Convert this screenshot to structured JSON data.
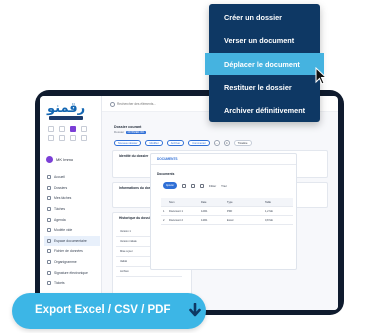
{
  "app": {
    "logo_text": "رقمنو",
    "workspace": "MK Immo"
  },
  "search": {
    "placeholder": "Rechercher des éléments..."
  },
  "sidebar": {
    "items": [
      {
        "label": "Accueil"
      },
      {
        "label": "Dossiers"
      },
      {
        "label": "Mes tâches"
      },
      {
        "label": "Tâches"
      },
      {
        "label": "Agenda"
      },
      {
        "label": "Modèle vide"
      },
      {
        "label": "Espace documentaire",
        "active": true
      },
      {
        "label": "Fichier de données"
      },
      {
        "label": "Organigramme"
      },
      {
        "label": "Signature électronique"
      },
      {
        "label": "Tickets"
      }
    ]
  },
  "page": {
    "title": "Dossier courant",
    "sub": "Dossier",
    "badge": "DOSSIER-001"
  },
  "toolbar": {
    "new_folder": "Nouveau dossier",
    "edit": "Modifier",
    "archive": "Archiver",
    "comment": "Commenter",
    "timeline": "Timeline"
  },
  "identity": {
    "title": "Identité du dossier",
    "type_label": "Type",
    "type_value": "Dossier standard",
    "cat_label": "Catégorie",
    "cat_value": "Gestion courante"
  },
  "info": {
    "title": "Informations du dossier",
    "created_label": "Date de création",
    "created_value": "Information du dossier",
    "author_label": "Créé par",
    "author_value": "Administrateur"
  },
  "versions": {
    "title": "Historique du dossier",
    "rows": [
      "Version 1",
      "Version initiale",
      "Mise à jour",
      "Validé",
      "Archivé"
    ]
  },
  "docs": {
    "header": "DOCUMENTS",
    "section": "Documents",
    "add_label": "Ajouter",
    "filter_label": "Filtrer",
    "print_label": "Trier",
    "columns": [
      "",
      "Nom",
      "Date",
      "Type",
      "Taille"
    ],
    "rows": [
      [
        "1",
        "Document 1",
        "12/01",
        "PDF",
        "1,2 Mo"
      ],
      [
        "2",
        "Document 2",
        "14/01",
        "Excel",
        "0,8 Mo"
      ]
    ]
  },
  "menu": {
    "items": [
      {
        "label": "Créer un dossier"
      },
      {
        "label": "Verser un document"
      },
      {
        "label": "Déplacer le document",
        "selected": true
      },
      {
        "label": "Restituer le dossier"
      },
      {
        "label": "Archiver définitivement"
      }
    ]
  },
  "export": {
    "label": "Export Excel / CSV / PDF"
  },
  "colors": {
    "accent": "#45b3e0",
    "menu_bg": "#0e3864",
    "brand": "#1467b3",
    "module_active": "#7b3fd6"
  }
}
